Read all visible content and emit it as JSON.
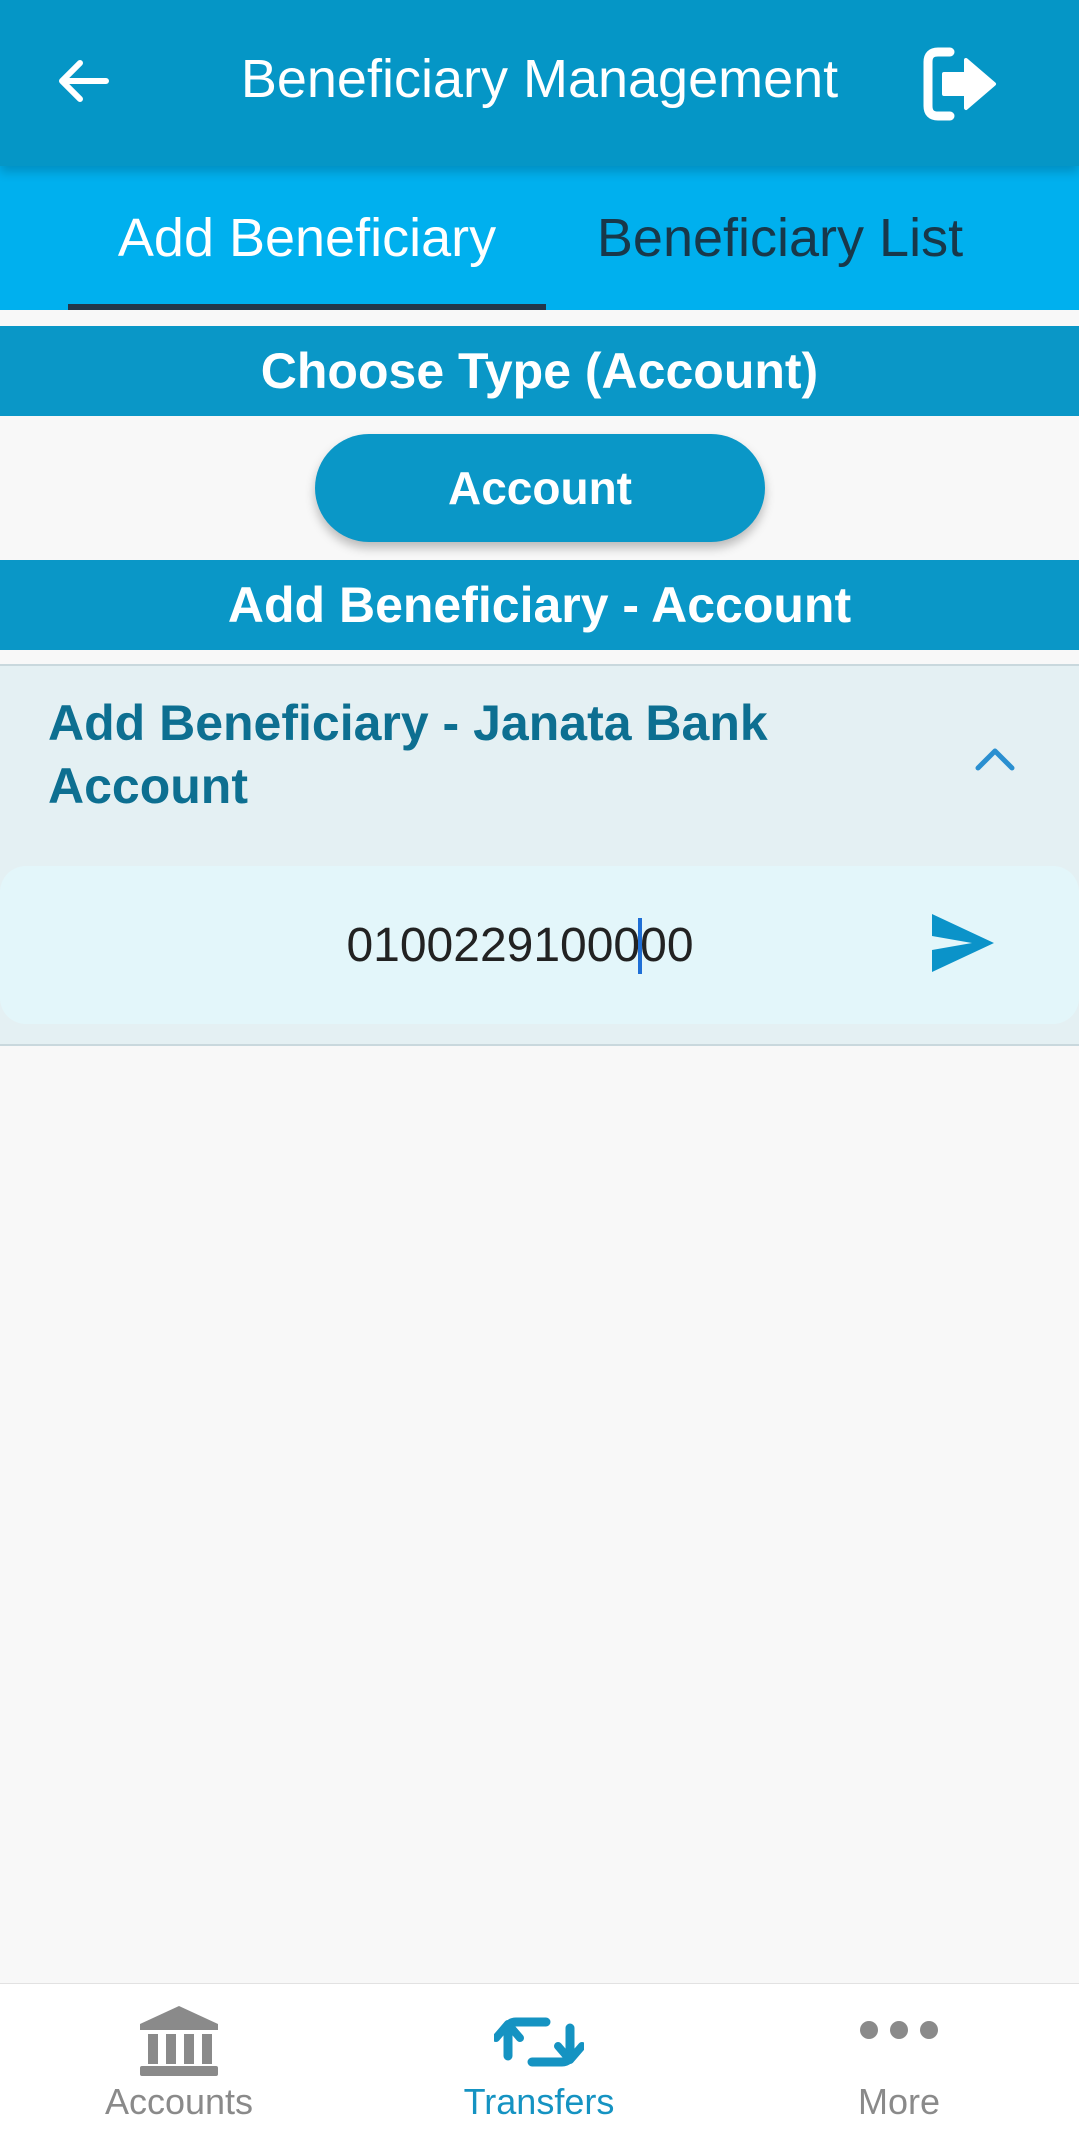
{
  "app_bar": {
    "title": "Beneficiary Management",
    "back_icon": "arrow-left-icon",
    "logout_icon": "sign-out-icon"
  },
  "tabs": [
    {
      "label": "Add Beneficiary",
      "active": true
    },
    {
      "label": "Beneficiary List",
      "active": false
    }
  ],
  "choose_type": {
    "header": "Choose Type (Account)",
    "button_label": "Account"
  },
  "add_section": {
    "header": "Add Beneficiary - Account"
  },
  "panel": {
    "title": "Add Beneficiary - Janata Bank Account",
    "expanded": true,
    "account_input_value": "0100229100000",
    "send_icon": "send-icon"
  },
  "bottom_nav": [
    {
      "label": "Accounts",
      "icon": "bank-icon",
      "active": false
    },
    {
      "label": "Transfers",
      "icon": "transfer-icon",
      "active": true
    },
    {
      "label": "More",
      "icon": "more-dots-icon",
      "active": false
    }
  ],
  "colors": {
    "app_bar": "#0596c6",
    "tab_bar": "#00b0ee",
    "section_header": "#0a97c7",
    "panel_title": "#0d6f91",
    "nav_active": "#1593c2",
    "nav_inactive": "#8a8a8a"
  }
}
